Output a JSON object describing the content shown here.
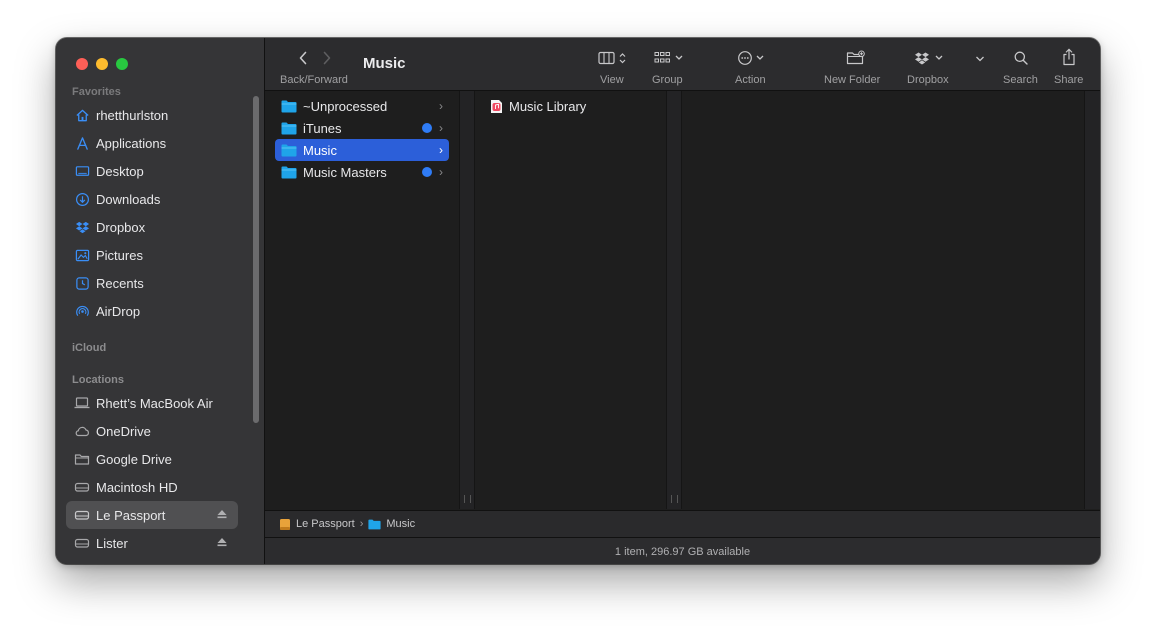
{
  "window": {
    "title": "Music"
  },
  "toolbar": {
    "back_forward_label": "Back/Forward",
    "view_label": "View",
    "group_label": "Group",
    "action_label": "Action",
    "new_folder_label": "New Folder",
    "dropbox_label": "Dropbox",
    "search_label": "Search",
    "share_label": "Share"
  },
  "sidebar": {
    "favorites_header": "Favorites",
    "favorites": [
      {
        "label": "rhetthurlston",
        "icon": "home-icon"
      },
      {
        "label": "Applications",
        "icon": "applications-icon"
      },
      {
        "label": "Desktop",
        "icon": "desktop-icon"
      },
      {
        "label": "Downloads",
        "icon": "downloads-icon"
      },
      {
        "label": "Dropbox",
        "icon": "dropbox-icon"
      },
      {
        "label": "Pictures",
        "icon": "pictures-icon"
      },
      {
        "label": "Recents",
        "icon": "recents-icon"
      },
      {
        "label": "AirDrop",
        "icon": "airdrop-icon"
      }
    ],
    "icloud_header": "iCloud",
    "locations_header": "Locations",
    "locations": [
      {
        "label": "Rhett’s MacBook Air",
        "icon": "laptop-icon"
      },
      {
        "label": "OneDrive",
        "icon": "cloud-icon"
      },
      {
        "label": "Google Drive",
        "icon": "folder-icon"
      },
      {
        "label": "Macintosh HD",
        "icon": "drive-icon"
      },
      {
        "label": "Le Passport",
        "icon": "drive-icon",
        "selected": true
      },
      {
        "label": "Lister",
        "icon": "drive-icon"
      }
    ]
  },
  "columns": {
    "first": [
      {
        "label": "~Unprocessed",
        "tag": null
      },
      {
        "label": "iTunes",
        "tag": "#2f7cf6"
      },
      {
        "label": "Music",
        "tag": null,
        "selected": true
      },
      {
        "label": "Music Masters",
        "tag": "#2f7cf6"
      }
    ],
    "second": [
      {
        "label": "Music Library",
        "icon": "music-library-icon"
      }
    ]
  },
  "pathbar": {
    "items": [
      "Le Passport",
      "Music"
    ],
    "separator": "›"
  },
  "status": {
    "text": "1 item, 296.97 GB available"
  },
  "colors": {
    "accent": "#2c5fd9",
    "folder": "#1fa4e9",
    "tag_blue": "#2f7cf6"
  }
}
